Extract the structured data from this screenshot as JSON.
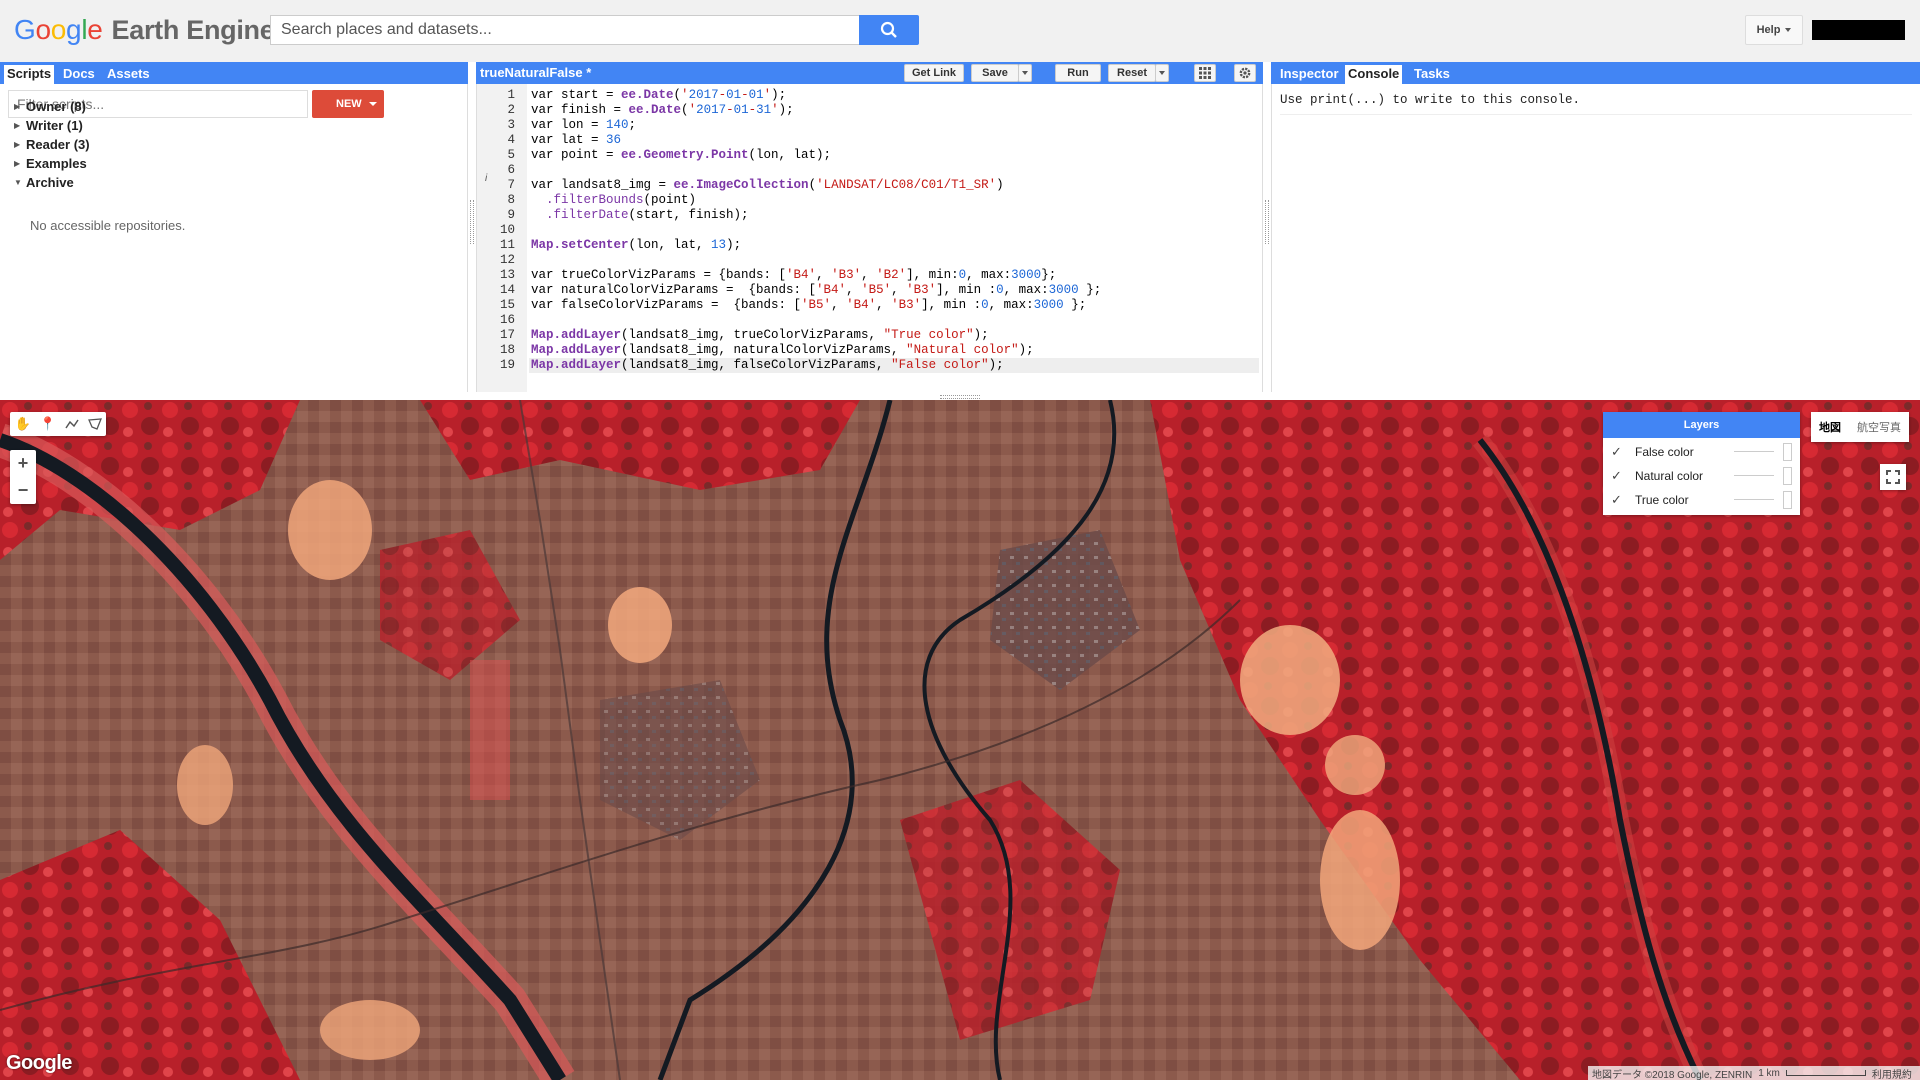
{
  "header": {
    "logo_google": [
      "G",
      "o",
      "o",
      "g",
      "l",
      "e"
    ],
    "logo_product": "Earth Engine",
    "search_placeholder": "Search places and datasets...",
    "help_label": "Help"
  },
  "left_panel": {
    "tabs": [
      {
        "label": "Scripts",
        "active": true
      },
      {
        "label": "Docs",
        "active": false
      },
      {
        "label": "Assets",
        "active": false
      }
    ],
    "filter_placeholder": "Filter scripts...",
    "new_button": "NEW",
    "tree": [
      {
        "label": "Owner  (8)",
        "expanded": false
      },
      {
        "label": "Writer  (1)",
        "expanded": false
      },
      {
        "label": "Reader  (3)",
        "expanded": false
      },
      {
        "label": "Examples",
        "expanded": false
      },
      {
        "label": "Archive",
        "expanded": true
      }
    ],
    "archive_message": "No accessible repositories."
  },
  "editor": {
    "title": "trueNaturalFalse *",
    "buttons": {
      "get_link": "Get Link",
      "save": "Save",
      "run": "Run",
      "reset": "Reset"
    },
    "line_numbers": [
      "1",
      "2",
      "3",
      "4",
      "5",
      "6",
      "7",
      "8",
      "9",
      "10",
      "11",
      "12",
      "13",
      "14",
      "15",
      "16",
      "17",
      "18",
      "19"
    ],
    "lines": [
      "var start = ee.Date('2017-01-01');",
      "var finish = ee.Date('2017-01-31');",
      "var lon = 140;",
      "var lat = 36",
      "var point = ee.Geometry.Point(lon, lat);",
      "",
      "var landsat8_img = ee.ImageCollection('LANDSAT/LC08/C01/T1_SR')",
      "  .filterBounds(point)",
      "  .filterDate(start, finish);",
      "",
      "Map.setCenter(lon, lat, 13);",
      "",
      "var trueColorVizParams = {bands: ['B4', 'B3', 'B2'], min:0, max:3000};",
      "var naturalColorVizParams =  {bands: ['B4', 'B5', 'B3'], min :0, max:3000 };",
      "var falseColorVizParams =  {bands: ['B5', 'B4', 'B3'], min :0, max:3000 };",
      "",
      "Map.addLayer(landsat8_img, trueColorVizParams, \"True color\");",
      "Map.addLayer(landsat8_img, naturalColorVizParams, \"Natural color\");",
      "Map.addLayer(landsat8_img, falseColorVizParams, \"False color\");"
    ],
    "current_line": 19
  },
  "right_panel": {
    "tabs": [
      {
        "label": "Inspector",
        "active": false
      },
      {
        "label": "Console",
        "active": true
      },
      {
        "label": "Tasks",
        "active": false
      }
    ],
    "console_message": "Use print(...) to write to this console."
  },
  "map": {
    "layers_title": "Layers",
    "layers": [
      {
        "name": "False color",
        "checked": true
      },
      {
        "name": "Natural color",
        "checked": true
      },
      {
        "name": "True color",
        "checked": true
      }
    ],
    "map_types": [
      "地図",
      "航空写真"
    ],
    "watermark": "Google",
    "attribution": "地図データ ©2018 Google, ZENRIN",
    "scale_label": "1 km",
    "terms": "利用規約"
  }
}
